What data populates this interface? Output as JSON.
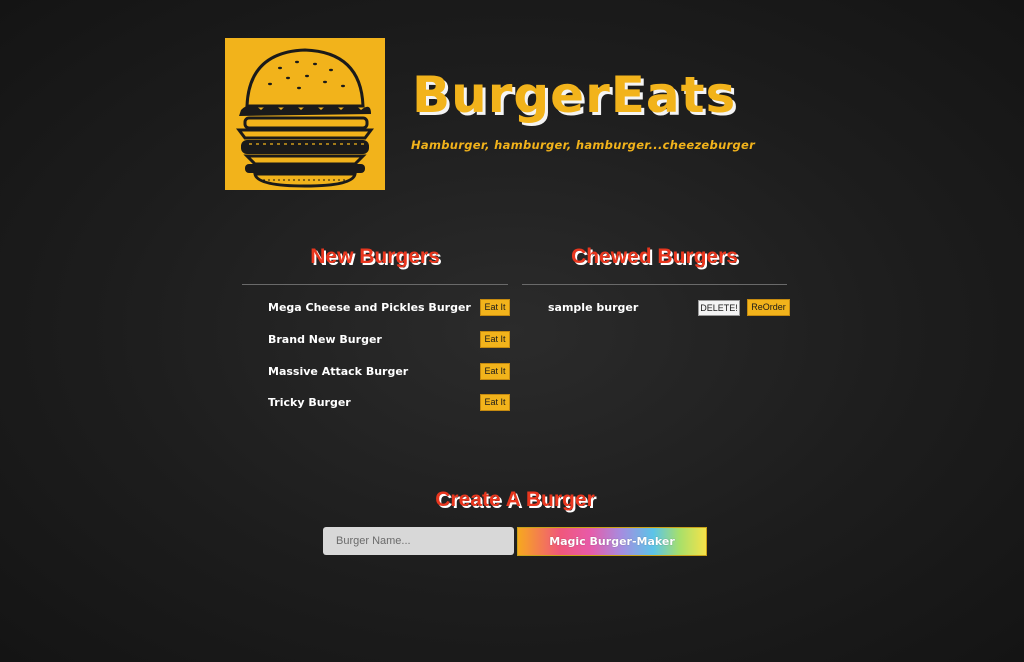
{
  "brand": {
    "title": "BurgerEats",
    "tagline": "Hamburger, hamburger, hamburger...cheezeburger"
  },
  "new_burgers": {
    "heading": "New Burgers",
    "eat_label": "Eat It",
    "items": [
      {
        "name": "Mega Cheese and Pickles Burger"
      },
      {
        "name": "Brand New Burger"
      },
      {
        "name": "Massive Attack Burger"
      },
      {
        "name": "Tricky Burger"
      }
    ]
  },
  "chewed_burgers": {
    "heading": "Chewed Burgers",
    "delete_label": "DELETE!",
    "reorder_label": "ReOrder",
    "items": [
      {
        "name": "sample burger"
      }
    ]
  },
  "create": {
    "heading": "Create A Burger",
    "input_placeholder": "Burger Name...",
    "input_value": "",
    "button_label": "Magic Burger-Maker"
  },
  "colors": {
    "background": "#1d1d1d",
    "brand_yellow": "#f2b31b",
    "heading_red": "#e8361e",
    "text_white": "#ffffff"
  },
  "icons": {
    "logo": "burger-logo-icon"
  }
}
